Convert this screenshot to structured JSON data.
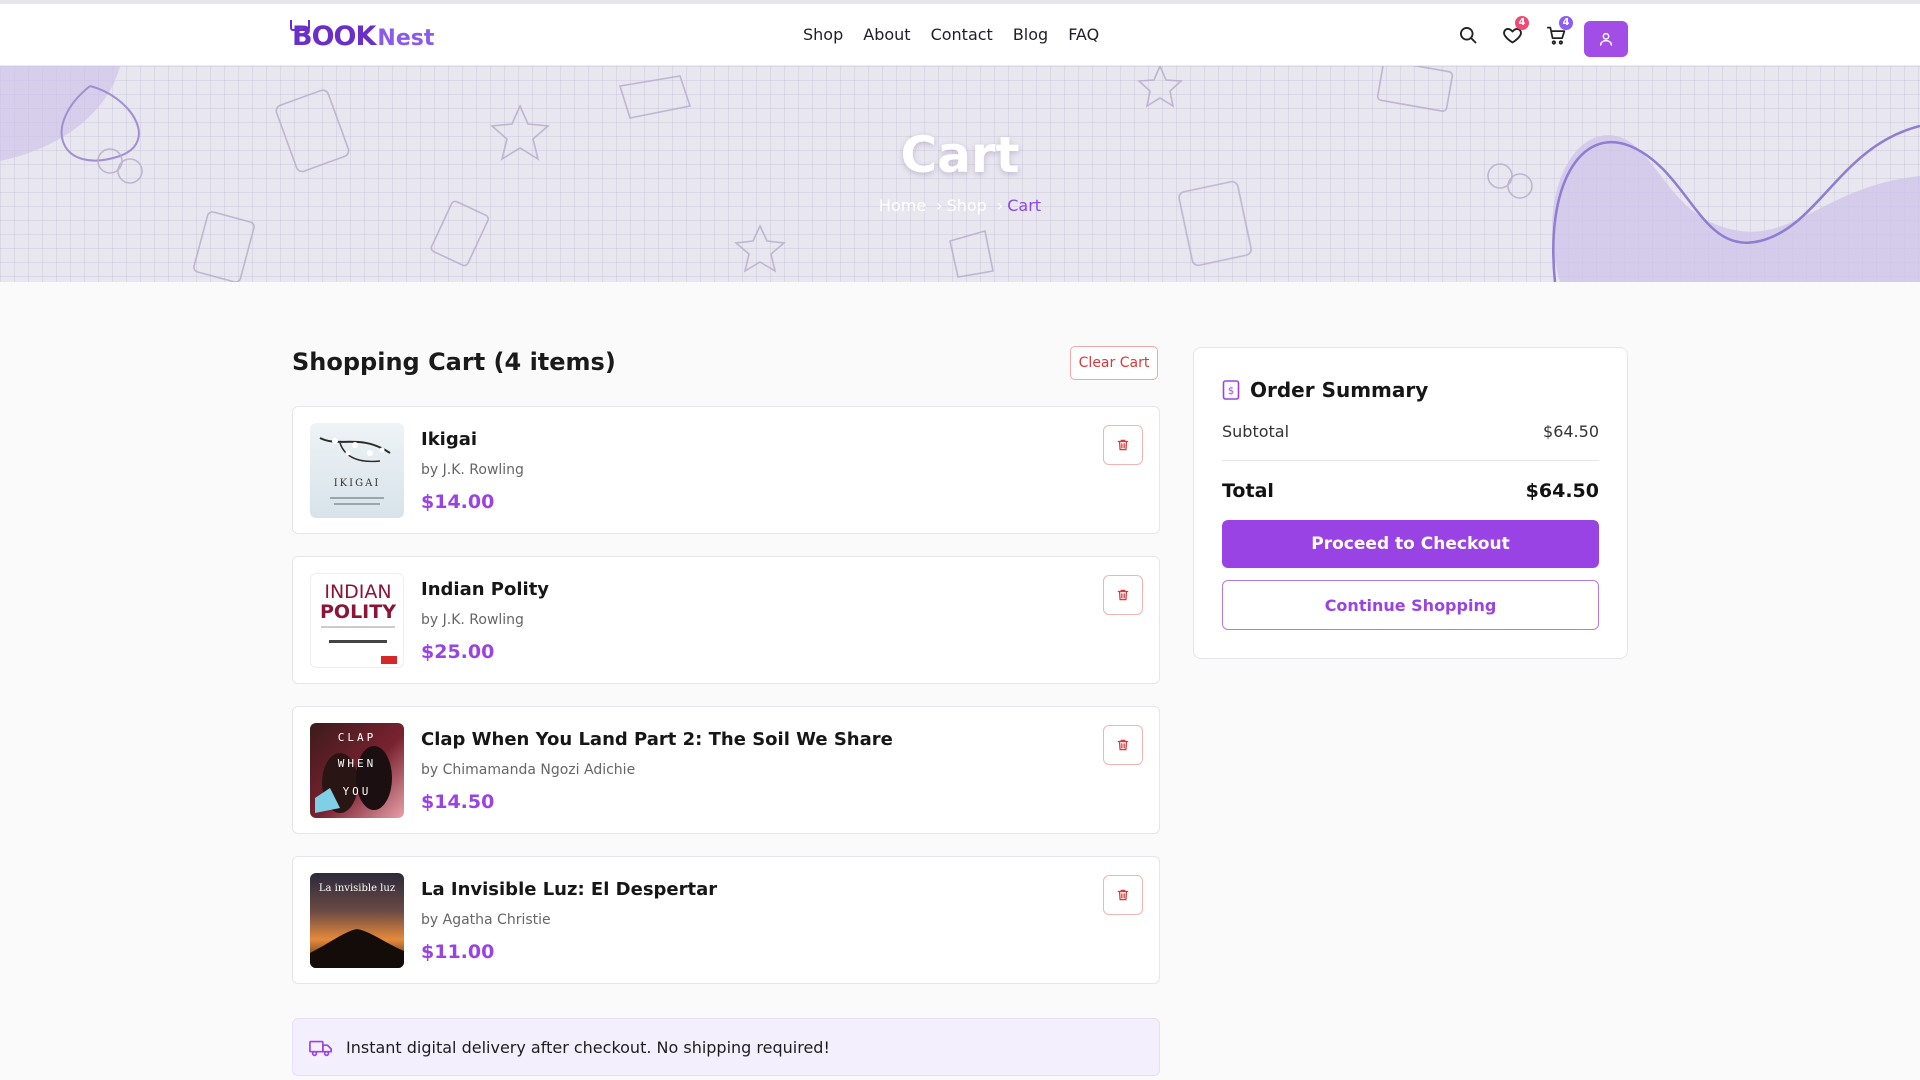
{
  "brand": {
    "logo_primary": "BOOK",
    "logo_secondary": "Nest"
  },
  "nav": {
    "links": [
      "Shop",
      "About",
      "Contact",
      "Blog",
      "FAQ"
    ]
  },
  "header_icons": {
    "search": "search-icon",
    "wishlist": {
      "icon": "heart-icon",
      "count": "4"
    },
    "cart": {
      "icon": "cart-icon",
      "count": "4"
    },
    "account": "user-icon"
  },
  "hero": {
    "title": "Cart",
    "breadcrumb": [
      "Home",
      "Shop",
      "Cart"
    ]
  },
  "cart": {
    "heading": "Shopping Cart (4 items)",
    "clear_label": "Clear Cart",
    "items": [
      {
        "title": "Ikigai",
        "author": "by J.K. Rowling",
        "price": "$14.00"
      },
      {
        "title": "Indian Polity",
        "author": "by J.K. Rowling",
        "price": "$25.00"
      },
      {
        "title": "Clap When You Land Part 2: The Soil We Share",
        "author": "by Chimamanda Ngozi Adichie",
        "price": "$14.50"
      },
      {
        "title": "La Invisible Luz: El Despertar",
        "author": "by Agatha Christie",
        "price": "$11.00"
      }
    ],
    "delivery_note": "Instant digital delivery after checkout. No shipping required!"
  },
  "summary": {
    "title": "Order Summary",
    "subtotal_label": "Subtotal",
    "subtotal_value": "$64.50",
    "total_label": "Total",
    "total_value": "$64.50",
    "checkout_label": "Proceed to Checkout",
    "continue_label": "Continue Shopping"
  },
  "colors": {
    "accent": "#9a43e4",
    "danger": "#d63a3a",
    "badge_red": "#ef4a73"
  }
}
